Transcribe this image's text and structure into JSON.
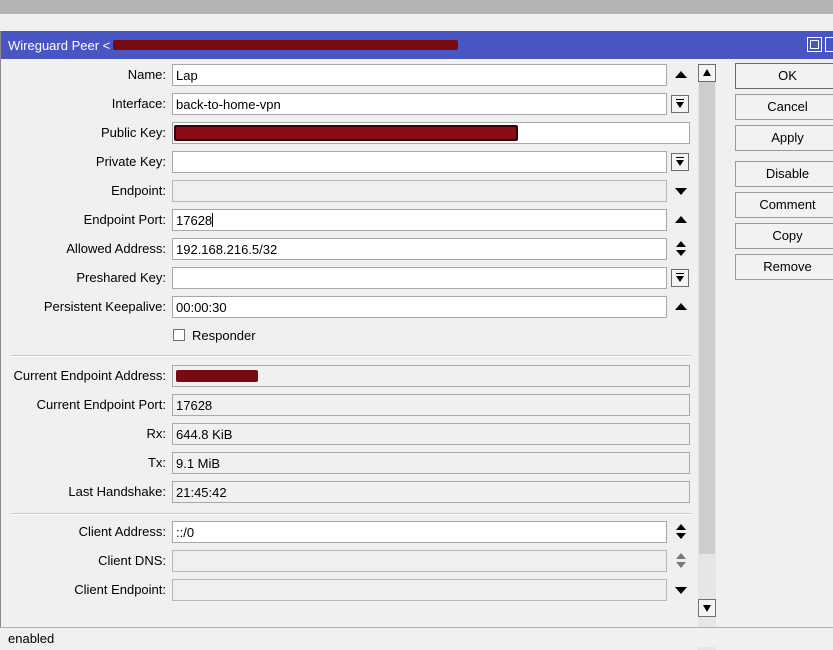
{
  "window": {
    "title": "Wireguard Peer <",
    "accent": "#4a55c4"
  },
  "form": {
    "name": {
      "label": "Name:",
      "value": "Lap"
    },
    "interface": {
      "label": "Interface:",
      "value": "back-to-home-vpn"
    },
    "public_key": {
      "label": "Public Key:",
      "value": ""
    },
    "private_key": {
      "label": "Private Key:",
      "value": ""
    },
    "endpoint": {
      "label": "Endpoint:",
      "value": ""
    },
    "endpoint_port": {
      "label": "Endpoint Port:",
      "value": "17628"
    },
    "allowed_address": {
      "label": "Allowed Address:",
      "value": "192.168.216.5/32"
    },
    "preshared_key": {
      "label": "Preshared Key:",
      "value": ""
    },
    "persistent_keepalive": {
      "label": "Persistent Keepalive:",
      "value": "00:00:30"
    },
    "responder": {
      "label": "Responder",
      "checked": false
    }
  },
  "status_info": {
    "current_endpoint_address": {
      "label": "Current Endpoint Address:",
      "value": ""
    },
    "current_endpoint_port": {
      "label": "Current Endpoint Port:",
      "value": "17628"
    },
    "rx": {
      "label": "Rx:",
      "value": "644.8 KiB"
    },
    "tx": {
      "label": "Tx:",
      "value": "9.1 MiB"
    },
    "last_handshake": {
      "label": "Last Handshake:",
      "value": "21:45:42"
    }
  },
  "client": {
    "client_address": {
      "label": "Client Address:",
      "value": "::/0"
    },
    "client_dns": {
      "label": "Client DNS:",
      "value": ""
    },
    "client_endpoint": {
      "label": "Client Endpoint:",
      "value": ""
    }
  },
  "buttons": {
    "ok": "OK",
    "cancel": "Cancel",
    "apply": "Apply",
    "disable": "Disable",
    "comment": "Comment",
    "copy": "Copy",
    "remove": "Remove"
  },
  "statusbar": {
    "text": "enabled"
  },
  "icons": [
    "maximize-icon",
    "scroll-up-icon",
    "scroll-down-icon",
    "dropdown-icon",
    "up-arrow-icon",
    "down-arrow-icon"
  ]
}
